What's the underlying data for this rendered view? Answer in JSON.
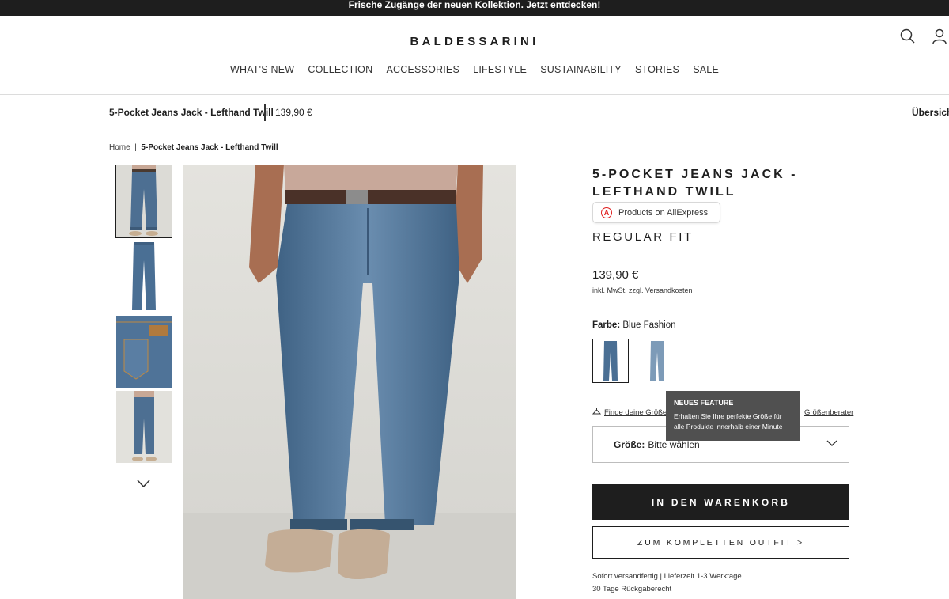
{
  "promo": {
    "text": "Frische Zugänge der neuen Kollektion.",
    "link": "Jetzt entdecken!"
  },
  "header": {
    "logo": "BALDESSARINI",
    "icons": [
      "search-icon",
      "user-icon"
    ]
  },
  "nav": [
    {
      "label": "WHAT'S NEW"
    },
    {
      "label": "COLLECTION"
    },
    {
      "label": "ACCESSORIES"
    },
    {
      "label": "LIFESTYLE"
    },
    {
      "label": "SUSTAINABILITY"
    },
    {
      "label": "STORIES"
    },
    {
      "label": "SALE"
    }
  ],
  "sticky": {
    "title": "5-Pocket Jeans Jack - Lefthand Twill",
    "price": "139,90 €",
    "right": "Übersicht"
  },
  "breadcrumb": {
    "home": "Home",
    "separator": "|",
    "current": "5-Pocket Jeans Jack - Lefthand Twill"
  },
  "product": {
    "title": "5-POCKET JEANS JACK - LEFTHAND TWILL",
    "aliexpress": "Products on AliExpress",
    "fit": "REGULAR FIT",
    "price": "139,90 €",
    "tax": "inkl. MwSt. zzgl. Versandkosten",
    "color_label": "Farbe:",
    "color_value": "Blue Fashion",
    "size_link": "Finde deine Größe",
    "size_advisor": "Größenberater",
    "size_label": "Größe:",
    "size_placeholder": "Bitte wählen",
    "add_to_cart": "IN DEN WARENKORB",
    "outfit": "ZUM KOMPLETTEN OUTFIT >",
    "shipping": "Sofort versandfertig | Lieferzeit 1-3 Werktage",
    "returns": "30 Tage Rückgaberecht"
  },
  "tooltip": {
    "title": "NEUES FEATURE",
    "body": "Erhalten Sie Ihre perfekte Größe für alle Produkte innerhalb einer Minute"
  },
  "colors": {
    "dark": "#1e1e1e",
    "denim": "#4a6f94",
    "tooltip": "#505050",
    "ali_red": "#e02020"
  }
}
